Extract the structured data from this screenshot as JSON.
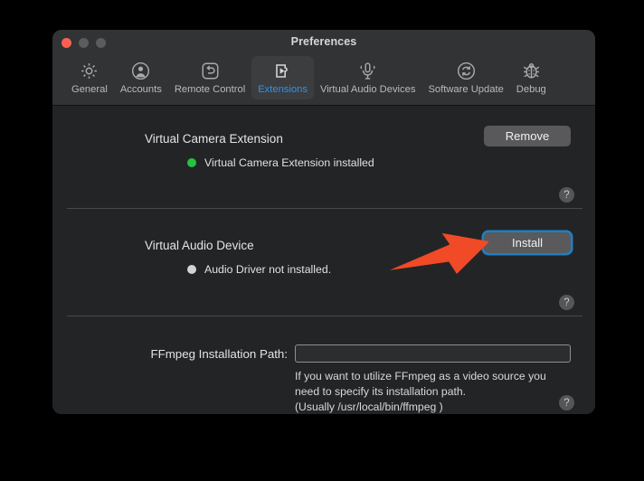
{
  "window": {
    "title": "Preferences",
    "traffic_lights": [
      {
        "name": "close",
        "color": "#ff5f52"
      },
      {
        "name": "minimize",
        "color": "#5b5c5e"
      },
      {
        "name": "maximize",
        "color": "#5b5c5e"
      }
    ]
  },
  "toolbar": {
    "tabs": [
      {
        "label": "General",
        "icon": "gear-icon",
        "active": false
      },
      {
        "label": "Accounts",
        "icon": "user-circle-icon",
        "active": false
      },
      {
        "label": "Remote Control",
        "icon": "remote-control-icon",
        "active": false
      },
      {
        "label": "Extensions",
        "icon": "puzzle-play-icon",
        "active": true
      },
      {
        "label": "Virtual Audio Devices",
        "icon": "microphone-icon",
        "active": false
      },
      {
        "label": "Software Update",
        "icon": "refresh-circle-icon",
        "active": false
      },
      {
        "label": "Debug",
        "icon": "ladybug-icon",
        "active": false
      }
    ],
    "active_tab_color": "#2f93e8"
  },
  "sections": {
    "camera": {
      "title": "Virtual Camera Extension",
      "status_text": "Virtual Camera Extension installed",
      "status_color": "#22c340",
      "button_label": "Remove",
      "help_label": "?"
    },
    "audio": {
      "title": "Virtual Audio Device",
      "status_text": "Audio Driver not installed.",
      "status_color": "#d2d3d4",
      "button_label": "Install",
      "button_focused": true,
      "focus_ring_color": "#1f7fc4",
      "help_label": "?"
    },
    "ffmpeg": {
      "label": "FFmpeg Installation Path:",
      "input_value": "",
      "input_placeholder": "",
      "hint": "If you want to utilize FFmpeg as a video source you\nneed to specify its installation path.\n(Usually /usr/local/bin/ffmpeg )",
      "help_label": "?"
    }
  },
  "annotation": {
    "arrow_color": "#f04a27",
    "arrow_points_to": "Install"
  }
}
